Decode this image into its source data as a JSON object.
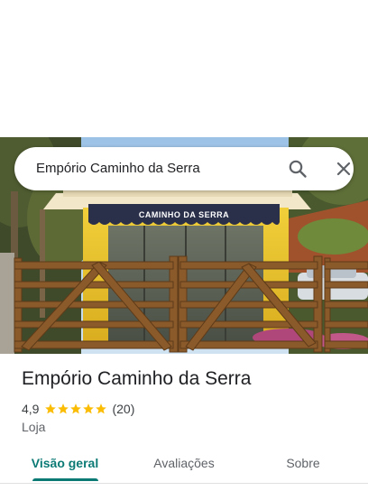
{
  "search": {
    "query": "Empório Caminho da Serra"
  },
  "photo": {
    "sign_text": "CAMINHO DA SERRA"
  },
  "place": {
    "name": "Empório Caminho da Serra",
    "rating": "4,9",
    "stars": 5,
    "review_count": "(20)",
    "category": "Loja"
  },
  "tabs": [
    {
      "label": "Visão geral",
      "active": true
    },
    {
      "label": "Avaliações",
      "active": false
    },
    {
      "label": "Sobre",
      "active": false
    }
  ],
  "colors": {
    "accent": "#0b7a75",
    "star": "#fbbc04",
    "wood": "#8b5a2b",
    "building": "#e8c231"
  },
  "icons": {
    "search": "search-icon",
    "close": "close-icon",
    "star": "star-icon"
  }
}
